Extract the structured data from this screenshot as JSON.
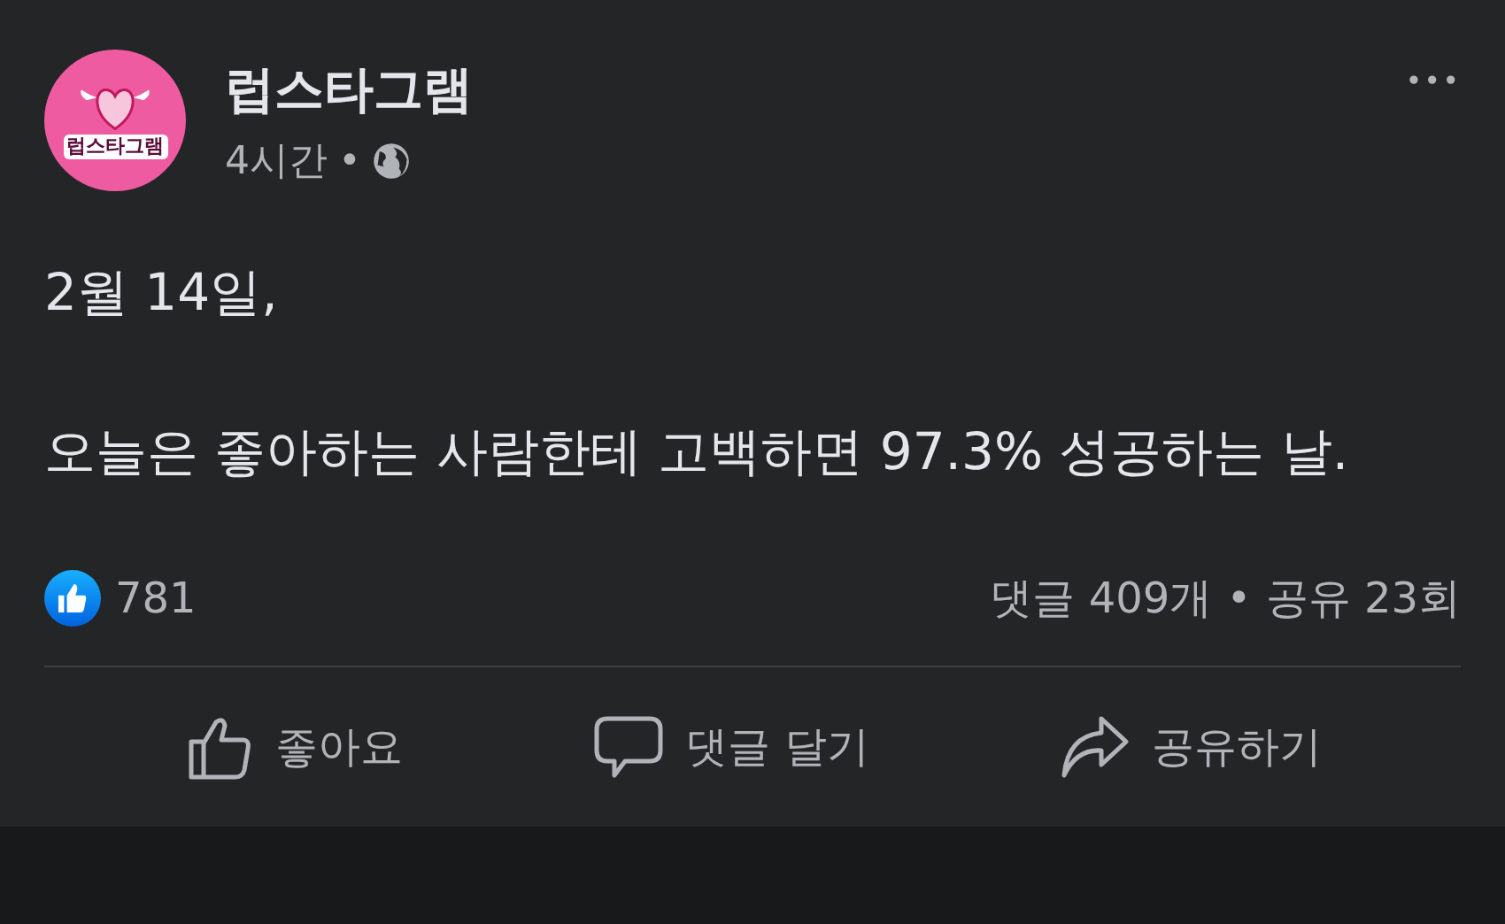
{
  "post": {
    "author": "럽스타그램",
    "avatar_text": "럽스타그램",
    "time": "4시간",
    "separator": "•",
    "menu": "•••",
    "paragraphs": [
      "2월 14일,",
      "오늘은 좋아하는 사람한테 고백하면 97.3% 성공하는 날."
    ],
    "likes": "781",
    "comments": "댓글 409개",
    "dot": "•",
    "shares": "공유 23회",
    "actions": [
      {
        "kind": "like",
        "label": "좋아요"
      },
      {
        "kind": "comment",
        "label": "댓글 달기"
      },
      {
        "kind": "share",
        "label": "공유하기"
      }
    ]
  }
}
